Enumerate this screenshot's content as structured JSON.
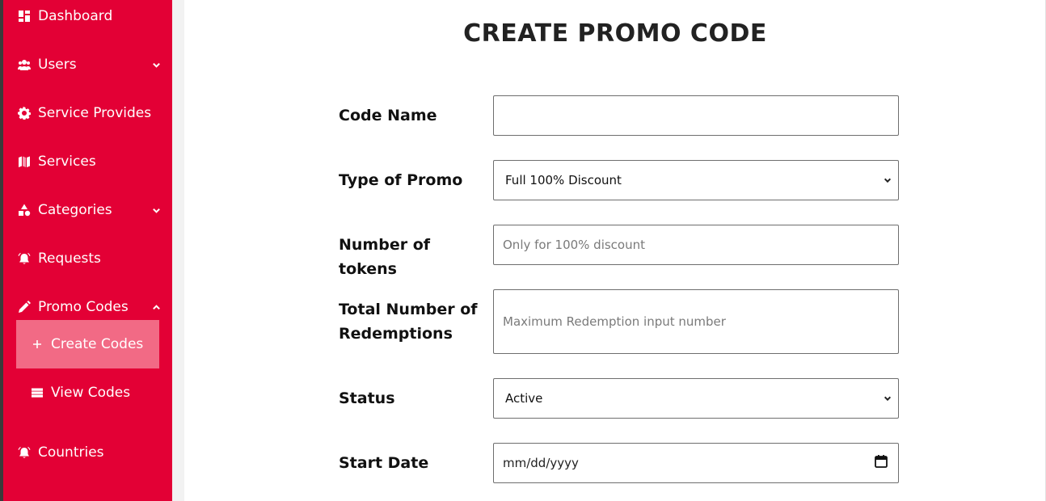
{
  "sidebar": {
    "items": [
      {
        "label": "Dashboard",
        "icon": "dashboard-icon"
      },
      {
        "label": "Users",
        "icon": "users-icon"
      },
      {
        "label": "Service Provides",
        "icon": "gear-icon"
      },
      {
        "label": "Services",
        "icon": "map-icon"
      },
      {
        "label": "Categories",
        "icon": "shapes-icon"
      },
      {
        "label": "Requests",
        "icon": "alarm-bell-icon"
      },
      {
        "label": "Promo Codes",
        "icon": "pencil-icon"
      },
      {
        "label": "Countries",
        "icon": "alarm-bell-icon"
      }
    ],
    "promo_sub": [
      {
        "label": "Create Codes",
        "icon": "plus-icon",
        "active": true
      },
      {
        "label": "View Codes",
        "icon": "list-icon",
        "active": false
      }
    ]
  },
  "colors": {
    "sidebar_bg": "#e30035",
    "active_sub_bg": "#f26a85"
  },
  "main": {
    "title": "CREATE PROMO CODE",
    "form": {
      "code_name": {
        "label": "Code Name",
        "value": "",
        "placeholder": ""
      },
      "promo_type": {
        "label": "Type of Promo",
        "selected": "Full 100% Discount"
      },
      "tokens": {
        "label": "Number of tokens",
        "value": "",
        "placeholder": "Only for 100% discount"
      },
      "redemptions": {
        "label_line1": "Total Number of",
        "label_line2": "Redemptions",
        "value": "",
        "placeholder": "Maximum Redemption input number"
      },
      "status": {
        "label": "Status",
        "selected": "Active"
      },
      "start_date": {
        "label": "Start Date",
        "value": "mm/dd/yyyy"
      }
    }
  }
}
